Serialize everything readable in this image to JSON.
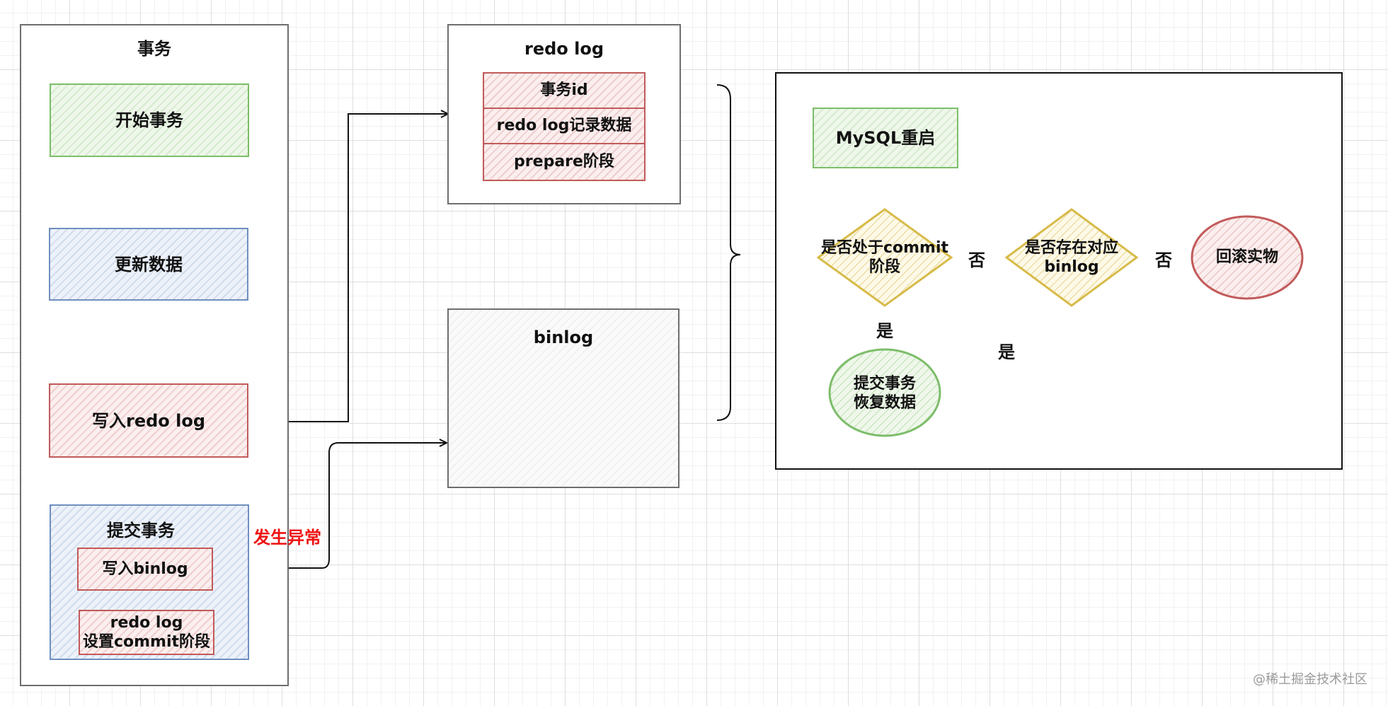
{
  "transaction": {
    "title": "事务",
    "start": "开始事务",
    "update": "更新数据",
    "write_redo": "写入redo log",
    "commit_title": "提交事务",
    "write_binlog": "写入binlog",
    "set_commit_line1": "redo log",
    "set_commit_line2": "设置commit阶段"
  },
  "exception_label": "发生异常",
  "redo_log": {
    "title": "redo log",
    "rows": [
      "事务id",
      "redo log记录数据",
      "prepare阶段"
    ]
  },
  "binlog": {
    "title": "binlog"
  },
  "recovery": {
    "restart": "MySQL重启",
    "check_commit_line1": "是否处于commit",
    "check_commit_line2": "阶段",
    "check_binlog_line1": "是否存在对应",
    "check_binlog_line2": "binlog",
    "rollback": "回滚实物",
    "commit_line1": "提交事务",
    "commit_line2": "恢复数据",
    "yes": "是",
    "no": "否"
  },
  "watermark": "@稀土掘金技术社区"
}
